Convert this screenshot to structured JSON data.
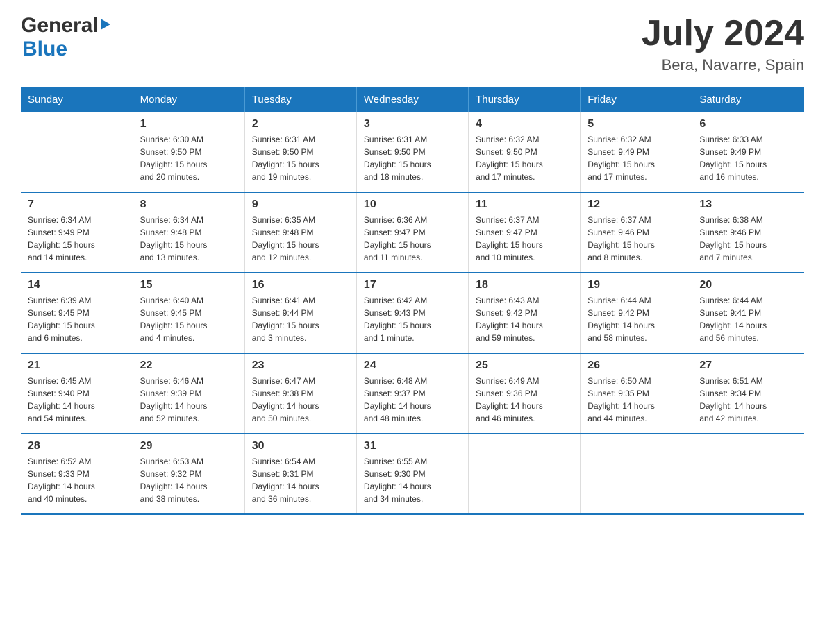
{
  "logo": {
    "general": "General",
    "blue": "Blue"
  },
  "title": {
    "month_year": "July 2024",
    "location": "Bera, Navarre, Spain"
  },
  "weekdays": [
    "Sunday",
    "Monday",
    "Tuesday",
    "Wednesday",
    "Thursday",
    "Friday",
    "Saturday"
  ],
  "weeks": [
    [
      {
        "day": "",
        "info": ""
      },
      {
        "day": "1",
        "info": "Sunrise: 6:30 AM\nSunset: 9:50 PM\nDaylight: 15 hours\nand 20 minutes."
      },
      {
        "day": "2",
        "info": "Sunrise: 6:31 AM\nSunset: 9:50 PM\nDaylight: 15 hours\nand 19 minutes."
      },
      {
        "day": "3",
        "info": "Sunrise: 6:31 AM\nSunset: 9:50 PM\nDaylight: 15 hours\nand 18 minutes."
      },
      {
        "day": "4",
        "info": "Sunrise: 6:32 AM\nSunset: 9:50 PM\nDaylight: 15 hours\nand 17 minutes."
      },
      {
        "day": "5",
        "info": "Sunrise: 6:32 AM\nSunset: 9:49 PM\nDaylight: 15 hours\nand 17 minutes."
      },
      {
        "day": "6",
        "info": "Sunrise: 6:33 AM\nSunset: 9:49 PM\nDaylight: 15 hours\nand 16 minutes."
      }
    ],
    [
      {
        "day": "7",
        "info": "Sunrise: 6:34 AM\nSunset: 9:49 PM\nDaylight: 15 hours\nand 14 minutes."
      },
      {
        "day": "8",
        "info": "Sunrise: 6:34 AM\nSunset: 9:48 PM\nDaylight: 15 hours\nand 13 minutes."
      },
      {
        "day": "9",
        "info": "Sunrise: 6:35 AM\nSunset: 9:48 PM\nDaylight: 15 hours\nand 12 minutes."
      },
      {
        "day": "10",
        "info": "Sunrise: 6:36 AM\nSunset: 9:47 PM\nDaylight: 15 hours\nand 11 minutes."
      },
      {
        "day": "11",
        "info": "Sunrise: 6:37 AM\nSunset: 9:47 PM\nDaylight: 15 hours\nand 10 minutes."
      },
      {
        "day": "12",
        "info": "Sunrise: 6:37 AM\nSunset: 9:46 PM\nDaylight: 15 hours\nand 8 minutes."
      },
      {
        "day": "13",
        "info": "Sunrise: 6:38 AM\nSunset: 9:46 PM\nDaylight: 15 hours\nand 7 minutes."
      }
    ],
    [
      {
        "day": "14",
        "info": "Sunrise: 6:39 AM\nSunset: 9:45 PM\nDaylight: 15 hours\nand 6 minutes."
      },
      {
        "day": "15",
        "info": "Sunrise: 6:40 AM\nSunset: 9:45 PM\nDaylight: 15 hours\nand 4 minutes."
      },
      {
        "day": "16",
        "info": "Sunrise: 6:41 AM\nSunset: 9:44 PM\nDaylight: 15 hours\nand 3 minutes."
      },
      {
        "day": "17",
        "info": "Sunrise: 6:42 AM\nSunset: 9:43 PM\nDaylight: 15 hours\nand 1 minute."
      },
      {
        "day": "18",
        "info": "Sunrise: 6:43 AM\nSunset: 9:42 PM\nDaylight: 14 hours\nand 59 minutes."
      },
      {
        "day": "19",
        "info": "Sunrise: 6:44 AM\nSunset: 9:42 PM\nDaylight: 14 hours\nand 58 minutes."
      },
      {
        "day": "20",
        "info": "Sunrise: 6:44 AM\nSunset: 9:41 PM\nDaylight: 14 hours\nand 56 minutes."
      }
    ],
    [
      {
        "day": "21",
        "info": "Sunrise: 6:45 AM\nSunset: 9:40 PM\nDaylight: 14 hours\nand 54 minutes."
      },
      {
        "day": "22",
        "info": "Sunrise: 6:46 AM\nSunset: 9:39 PM\nDaylight: 14 hours\nand 52 minutes."
      },
      {
        "day": "23",
        "info": "Sunrise: 6:47 AM\nSunset: 9:38 PM\nDaylight: 14 hours\nand 50 minutes."
      },
      {
        "day": "24",
        "info": "Sunrise: 6:48 AM\nSunset: 9:37 PM\nDaylight: 14 hours\nand 48 minutes."
      },
      {
        "day": "25",
        "info": "Sunrise: 6:49 AM\nSunset: 9:36 PM\nDaylight: 14 hours\nand 46 minutes."
      },
      {
        "day": "26",
        "info": "Sunrise: 6:50 AM\nSunset: 9:35 PM\nDaylight: 14 hours\nand 44 minutes."
      },
      {
        "day": "27",
        "info": "Sunrise: 6:51 AM\nSunset: 9:34 PM\nDaylight: 14 hours\nand 42 minutes."
      }
    ],
    [
      {
        "day": "28",
        "info": "Sunrise: 6:52 AM\nSunset: 9:33 PM\nDaylight: 14 hours\nand 40 minutes."
      },
      {
        "day": "29",
        "info": "Sunrise: 6:53 AM\nSunset: 9:32 PM\nDaylight: 14 hours\nand 38 minutes."
      },
      {
        "day": "30",
        "info": "Sunrise: 6:54 AM\nSunset: 9:31 PM\nDaylight: 14 hours\nand 36 minutes."
      },
      {
        "day": "31",
        "info": "Sunrise: 6:55 AM\nSunset: 9:30 PM\nDaylight: 14 hours\nand 34 minutes."
      },
      {
        "day": "",
        "info": ""
      },
      {
        "day": "",
        "info": ""
      },
      {
        "day": "",
        "info": ""
      }
    ]
  ]
}
